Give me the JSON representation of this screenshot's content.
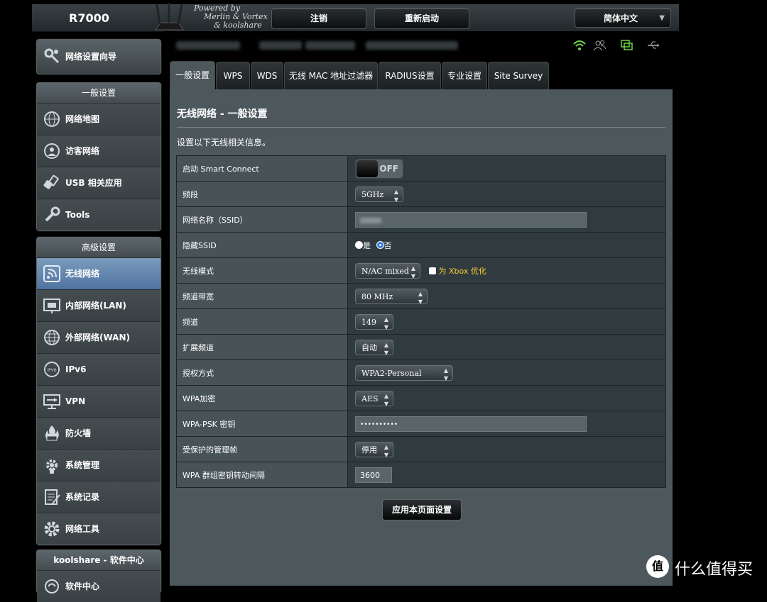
{
  "header": {
    "model": "R7000",
    "powered_lines": [
      "Powered by",
      "Merlin & Vortex",
      "& koolshare"
    ],
    "logout_label": "注销",
    "reboot_label": "重新启动",
    "language": "简体中文"
  },
  "sidebar": {
    "wizard_label": "网络设置向导",
    "general_title": "一般设置",
    "general_items": [
      {
        "label": "网络地图",
        "icon": "globe-map-icon"
      },
      {
        "label": "访客网络",
        "icon": "guest-network-icon"
      },
      {
        "label": "USB 相关应用",
        "icon": "usb-icon"
      },
      {
        "label": "Tools",
        "icon": "wrench-icon"
      }
    ],
    "advanced_title": "高级设置",
    "advanced_items": [
      {
        "label": "无线网络",
        "icon": "wireless-icon",
        "active": true
      },
      {
        "label": "内部网络(LAN)",
        "icon": "lan-icon"
      },
      {
        "label": "外部网络(WAN)",
        "icon": "wan-globe-icon"
      },
      {
        "label": "IPv6",
        "icon": "ipv6-icon"
      },
      {
        "label": "VPN",
        "icon": "vpn-icon"
      },
      {
        "label": "防火墙",
        "icon": "firewall-icon"
      },
      {
        "label": "系统管理",
        "icon": "admin-icon"
      },
      {
        "label": "系统记录",
        "icon": "log-icon"
      },
      {
        "label": "网络工具",
        "icon": "network-tools-icon"
      }
    ],
    "koolshare_title": "koolshare - 软件中心",
    "koolshare_items": [
      {
        "label": "软件中心",
        "icon": "software-center-icon"
      }
    ]
  },
  "tabs": [
    "一般设置",
    "WPS",
    "WDS",
    "无线 MAC 地址过滤器",
    "RADIUS设置",
    "专业设置",
    "Site Survey"
  ],
  "main": {
    "title": "无线网络 - 一般设置",
    "description": "设置以下无线相关信息。",
    "apply_label": "应用本页面设置"
  },
  "settings": {
    "smart_connect": {
      "label": "启动 Smart Connect",
      "value": "OFF"
    },
    "band": {
      "label": "频段",
      "value": "5GHz"
    },
    "ssid": {
      "label": "网络名称（SSID）",
      "value": ""
    },
    "hide_ssid": {
      "label": "隐藏SSID",
      "yes": "是",
      "no": "否",
      "selected": "否"
    },
    "wireless_mode": {
      "label": "无线模式",
      "value": "N/AC mixed",
      "xbox_label": "为 Xbox 优化"
    },
    "channel_bandwidth": {
      "label": "频道带宽",
      "value": "80 MHz"
    },
    "channel": {
      "label": "频道",
      "value": "149"
    },
    "extension_channel": {
      "label": "扩展频道",
      "value": "自动"
    },
    "auth_method": {
      "label": "授权方式",
      "value": "WPA2-Personal"
    },
    "wpa_encryption": {
      "label": "WPA加密",
      "value": "AES"
    },
    "wpa_psk": {
      "label": "WPA-PSK 密钥",
      "value": "••••••••••"
    },
    "pmf": {
      "label": "受保护的管理帧",
      "value": "停用"
    },
    "group_key_interval": {
      "label": "WPA 群组密钥转动间隔",
      "value": "3600"
    }
  },
  "watermark": {
    "logo": "值",
    "text": "什么值得买"
  },
  "colors": {
    "active_menu": "#6386b0",
    "panel_bg": "#4d585c",
    "wifi_green": "#6ad84a",
    "xbox_yellow": "#ffcc33"
  }
}
